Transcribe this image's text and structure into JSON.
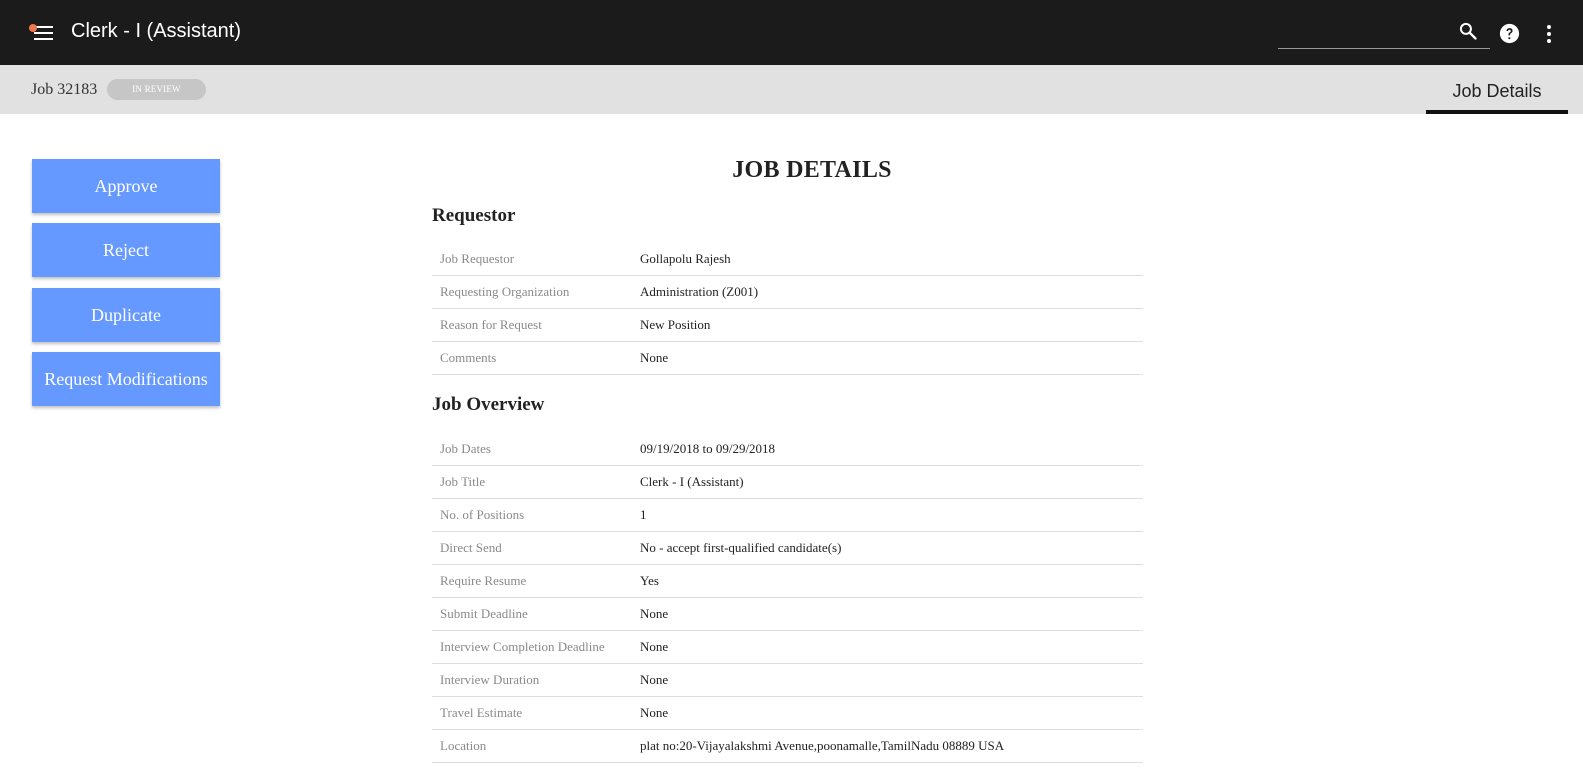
{
  "app_bar": {
    "title": "Clerk - I (Assistant)",
    "search_value": "",
    "icons": [
      "menu-icon",
      "search-icon",
      "help-icon",
      "more-vert-icon"
    ],
    "notification_dot_color": "#f0764e"
  },
  "sub_header": {
    "job_id": "Job 32183",
    "status": "IN REVIEW",
    "active_tab": "Job Details"
  },
  "actions": {
    "approve": "Approve",
    "reject": "Reject",
    "duplicate": "Duplicate",
    "request_modifications": "Request Modifications"
  },
  "main": {
    "page_title": "JOB DETAILS",
    "requestor": {
      "title": "Requestor",
      "rows": [
        {
          "label": "Job Requestor",
          "value": "Gollapolu Rajesh"
        },
        {
          "label": "Requesting Organization",
          "value": "Administration (Z001)"
        },
        {
          "label": "Reason for Request",
          "value": "New Position"
        },
        {
          "label": "Comments",
          "value": "None"
        }
      ]
    },
    "overview": {
      "title": "Job Overview",
      "rows": [
        {
          "label": "Job Dates",
          "value": "09/19/2018 to 09/29/2018"
        },
        {
          "label": "Job Title",
          "value": "Clerk - I (Assistant)"
        },
        {
          "label": "No. of Positions",
          "value": "1"
        },
        {
          "label": "Direct Send",
          "value": "No - accept first-qualified candidate(s)"
        },
        {
          "label": "Require Resume",
          "value": "Yes"
        },
        {
          "label": "Submit Deadline",
          "value": "None"
        },
        {
          "label": "Interview Completion Deadline",
          "value": "None"
        },
        {
          "label": "Interview Duration",
          "value": "None"
        },
        {
          "label": "Travel Estimate",
          "value": "None"
        },
        {
          "label": "Location",
          "value": "plat no:20-Vijayalakshmi Avenue,poonamalle,TamilNadu 08889 USA"
        }
      ]
    }
  },
  "colors": {
    "app_bar": "#1b1b1b",
    "sub_header": "#e1e1e1",
    "action_button": "#6699ff",
    "status_badge": "#c6c6c6"
  }
}
